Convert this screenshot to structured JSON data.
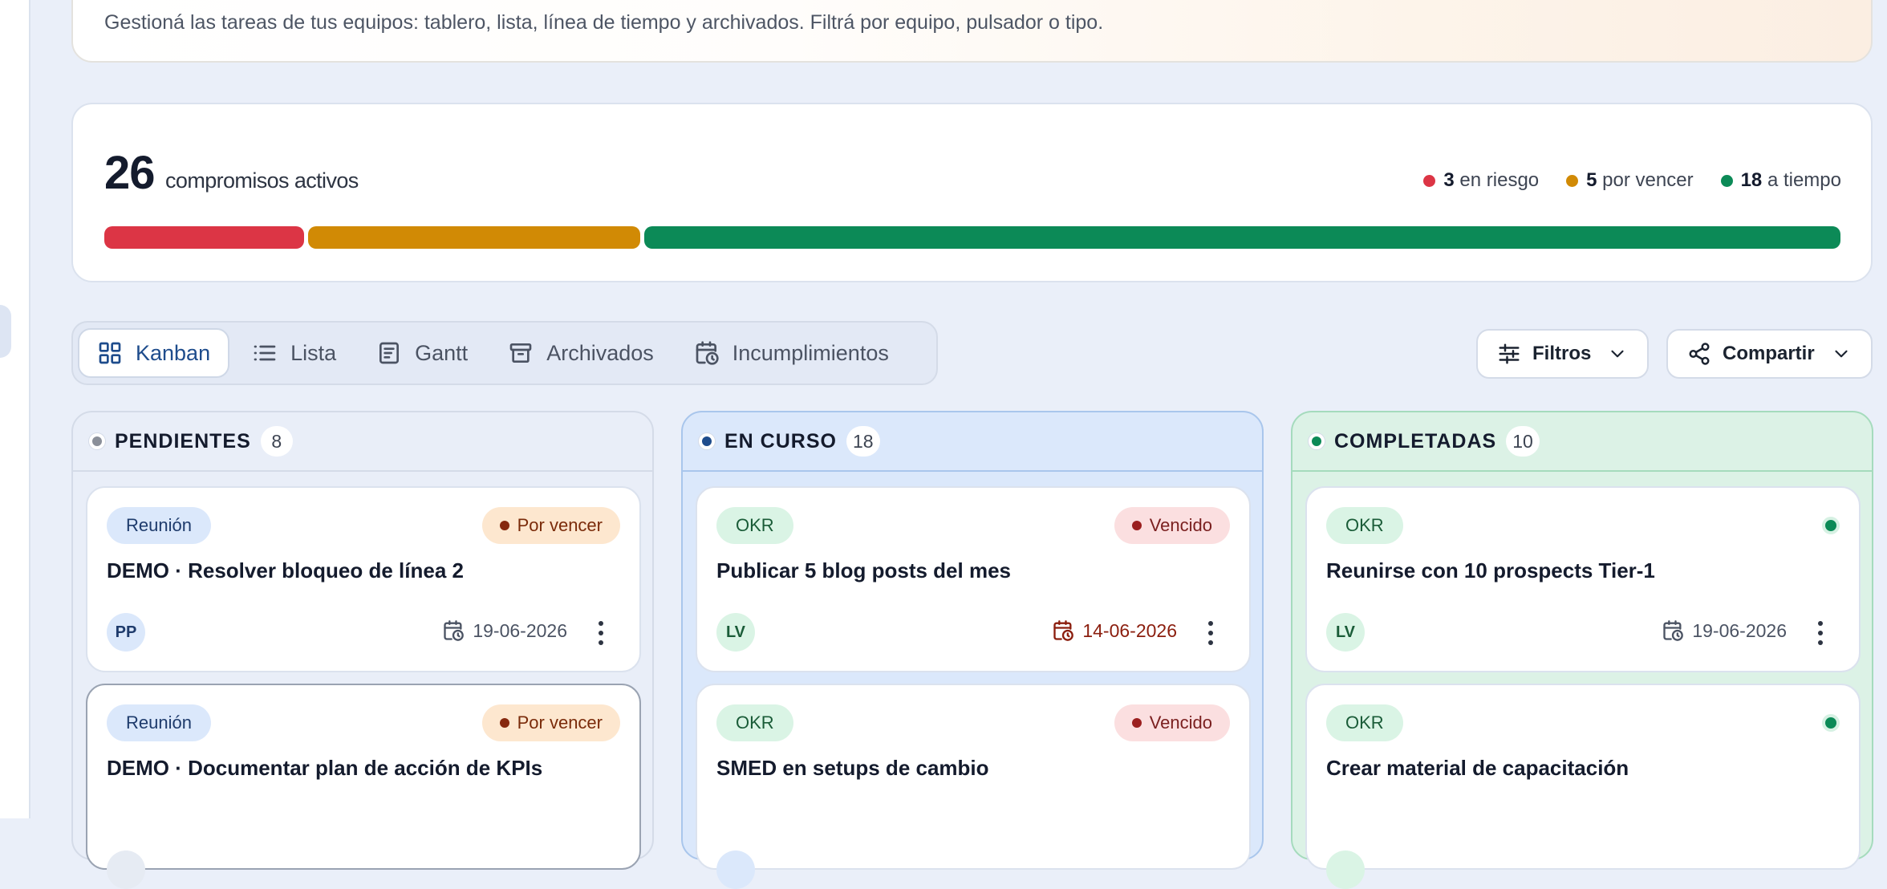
{
  "header": {
    "description": "Gestioná las tareas de tus equipos: tablero, lista, línea de tiempo y archivados. Filtrá por equipo, pulsador o tipo."
  },
  "summary": {
    "count": "26",
    "label": "compromisos activos",
    "legend": [
      {
        "count": "3",
        "label": "en riesgo",
        "color": "#dc3545"
      },
      {
        "count": "5",
        "label": "por vencer",
        "color": "#d18a05"
      },
      {
        "count": "18",
        "label": "a tiempo",
        "color": "#0c8a57"
      }
    ]
  },
  "progress": {
    "segments": [
      {
        "value": 3,
        "color": "#dc3545"
      },
      {
        "value": 5,
        "color": "#d18a05"
      },
      {
        "value": 18,
        "color": "#0c8a57"
      }
    ]
  },
  "tabs": [
    {
      "label": "Kanban",
      "icon": "grid-icon",
      "active": true
    },
    {
      "label": "Lista",
      "icon": "list-icon",
      "active": false
    },
    {
      "label": "Gantt",
      "icon": "gantt-icon",
      "active": false
    },
    {
      "label": "Archivados",
      "icon": "archive-icon",
      "active": false
    },
    {
      "label": "Incumplimientos",
      "icon": "calendar-clock-icon",
      "active": false
    }
  ],
  "actions": {
    "filters_label": "Filtros",
    "share_label": "Compartir"
  },
  "columns": [
    {
      "title": "PENDIENTES",
      "count": "8",
      "dot_color": "#8a8f99",
      "cards": [
        {
          "tag": "Reunión",
          "status": "Por vencer",
          "title": "DEMO · Resolver bloqueo de línea 2",
          "avatar": "PP",
          "date": "19-06-2026"
        },
        {
          "tag": "Reunión",
          "status": "Por vencer",
          "title": "DEMO · Documentar plan de acción de KPIs",
          "avatar": "",
          "date": ""
        }
      ]
    },
    {
      "title": "EN CURSO",
      "count": "18",
      "dot_color": "#1e4c8c",
      "cards": [
        {
          "tag": "OKR",
          "status": "Vencido",
          "title": "Publicar 5 blog posts del mes",
          "avatar": "LV",
          "date": "14-06-2026"
        },
        {
          "tag": "OKR",
          "status": "Vencido",
          "title": "SMED en setups de cambio",
          "avatar": "",
          "date": ""
        }
      ]
    },
    {
      "title": "COMPLETADAS",
      "count": "10",
      "dot_color": "#0c8a57",
      "cards": [
        {
          "tag": "OKR",
          "status": "",
          "title": "Reunirse con 10 prospects Tier-1",
          "avatar": "LV",
          "date": "19-06-2026"
        },
        {
          "tag": "OKR",
          "status": "",
          "title": "Crear material de capacitación",
          "avatar": "",
          "date": ""
        }
      ]
    }
  ]
}
